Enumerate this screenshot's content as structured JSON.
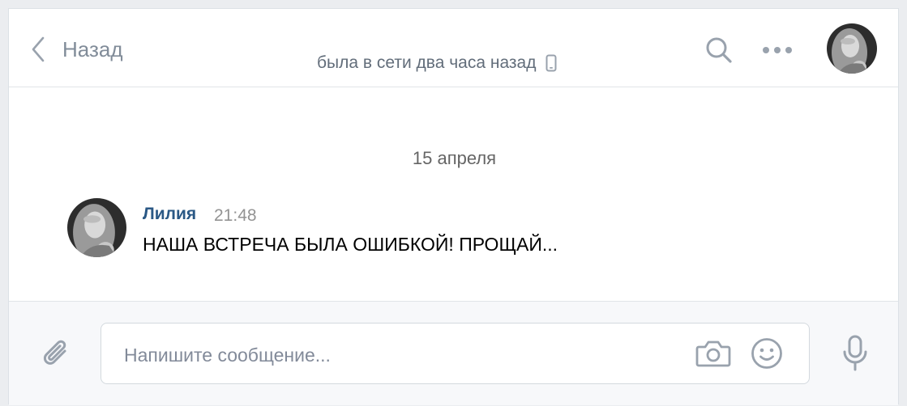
{
  "header": {
    "back_label": "Назад",
    "status_text": "была в сети два часа назад",
    "status_device_icon": "phone-icon",
    "search_icon": "search-icon",
    "more_icon": "more-dots-icon"
  },
  "messages": {
    "date_separator": "15 апреля",
    "items": [
      {
        "author": "Лилия",
        "time": "21:48",
        "text": "НАША ВСТРЕЧА БЫЛА ОШИБКОЙ! ПРОЩАЙ..."
      }
    ]
  },
  "composer": {
    "placeholder": "Напишите сообщение...",
    "value": "",
    "attach_icon": "paperclip-icon",
    "camera_icon": "camera-icon",
    "emoji_icon": "smile-icon",
    "mic_icon": "microphone-icon"
  },
  "colors": {
    "author_link": "#2a5885",
    "icon_gray": "#99a2ad",
    "page_background": "#ebedf0"
  }
}
